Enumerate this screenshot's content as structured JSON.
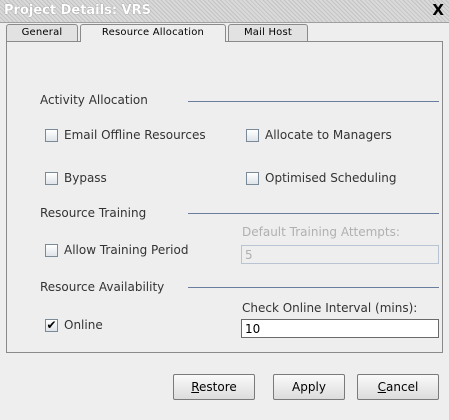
{
  "window": {
    "title": "Project Details: VRS",
    "close_glyph": "X"
  },
  "tabs": [
    {
      "label": "General",
      "active": false
    },
    {
      "label": "Resource Allocation",
      "active": true
    },
    {
      "label": "Mail Host",
      "active": false
    }
  ],
  "activity_allocation": {
    "heading": "Activity Allocation",
    "email_offline": {
      "label": "Email Offline Resources",
      "checked": false
    },
    "allocate_managers": {
      "label": "Allocate to Managers",
      "checked": false
    },
    "bypass": {
      "label": "Bypass",
      "checked": false
    },
    "optimised": {
      "label": "Optimised Scheduling",
      "checked": false
    }
  },
  "resource_training": {
    "heading": "Resource Training",
    "allow_training": {
      "label": "Allow Training Period",
      "checked": false
    },
    "attempts_label": "Default Training Attempts:",
    "attempts_value": "5"
  },
  "resource_availability": {
    "heading": "Resource Availability",
    "online": {
      "label": "Online",
      "checked": true,
      "mark": "✔"
    },
    "interval_label": "Check Online Interval (mins):",
    "interval_value": "10"
  },
  "buttons": {
    "restore_mnemonic": "R",
    "restore_rest": "estore",
    "apply": "Apply",
    "cancel_mnemonic": "C",
    "cancel_rest": "ancel"
  },
  "colors": {
    "separator": "#6b7d9e",
    "background": "#eeeeee"
  }
}
